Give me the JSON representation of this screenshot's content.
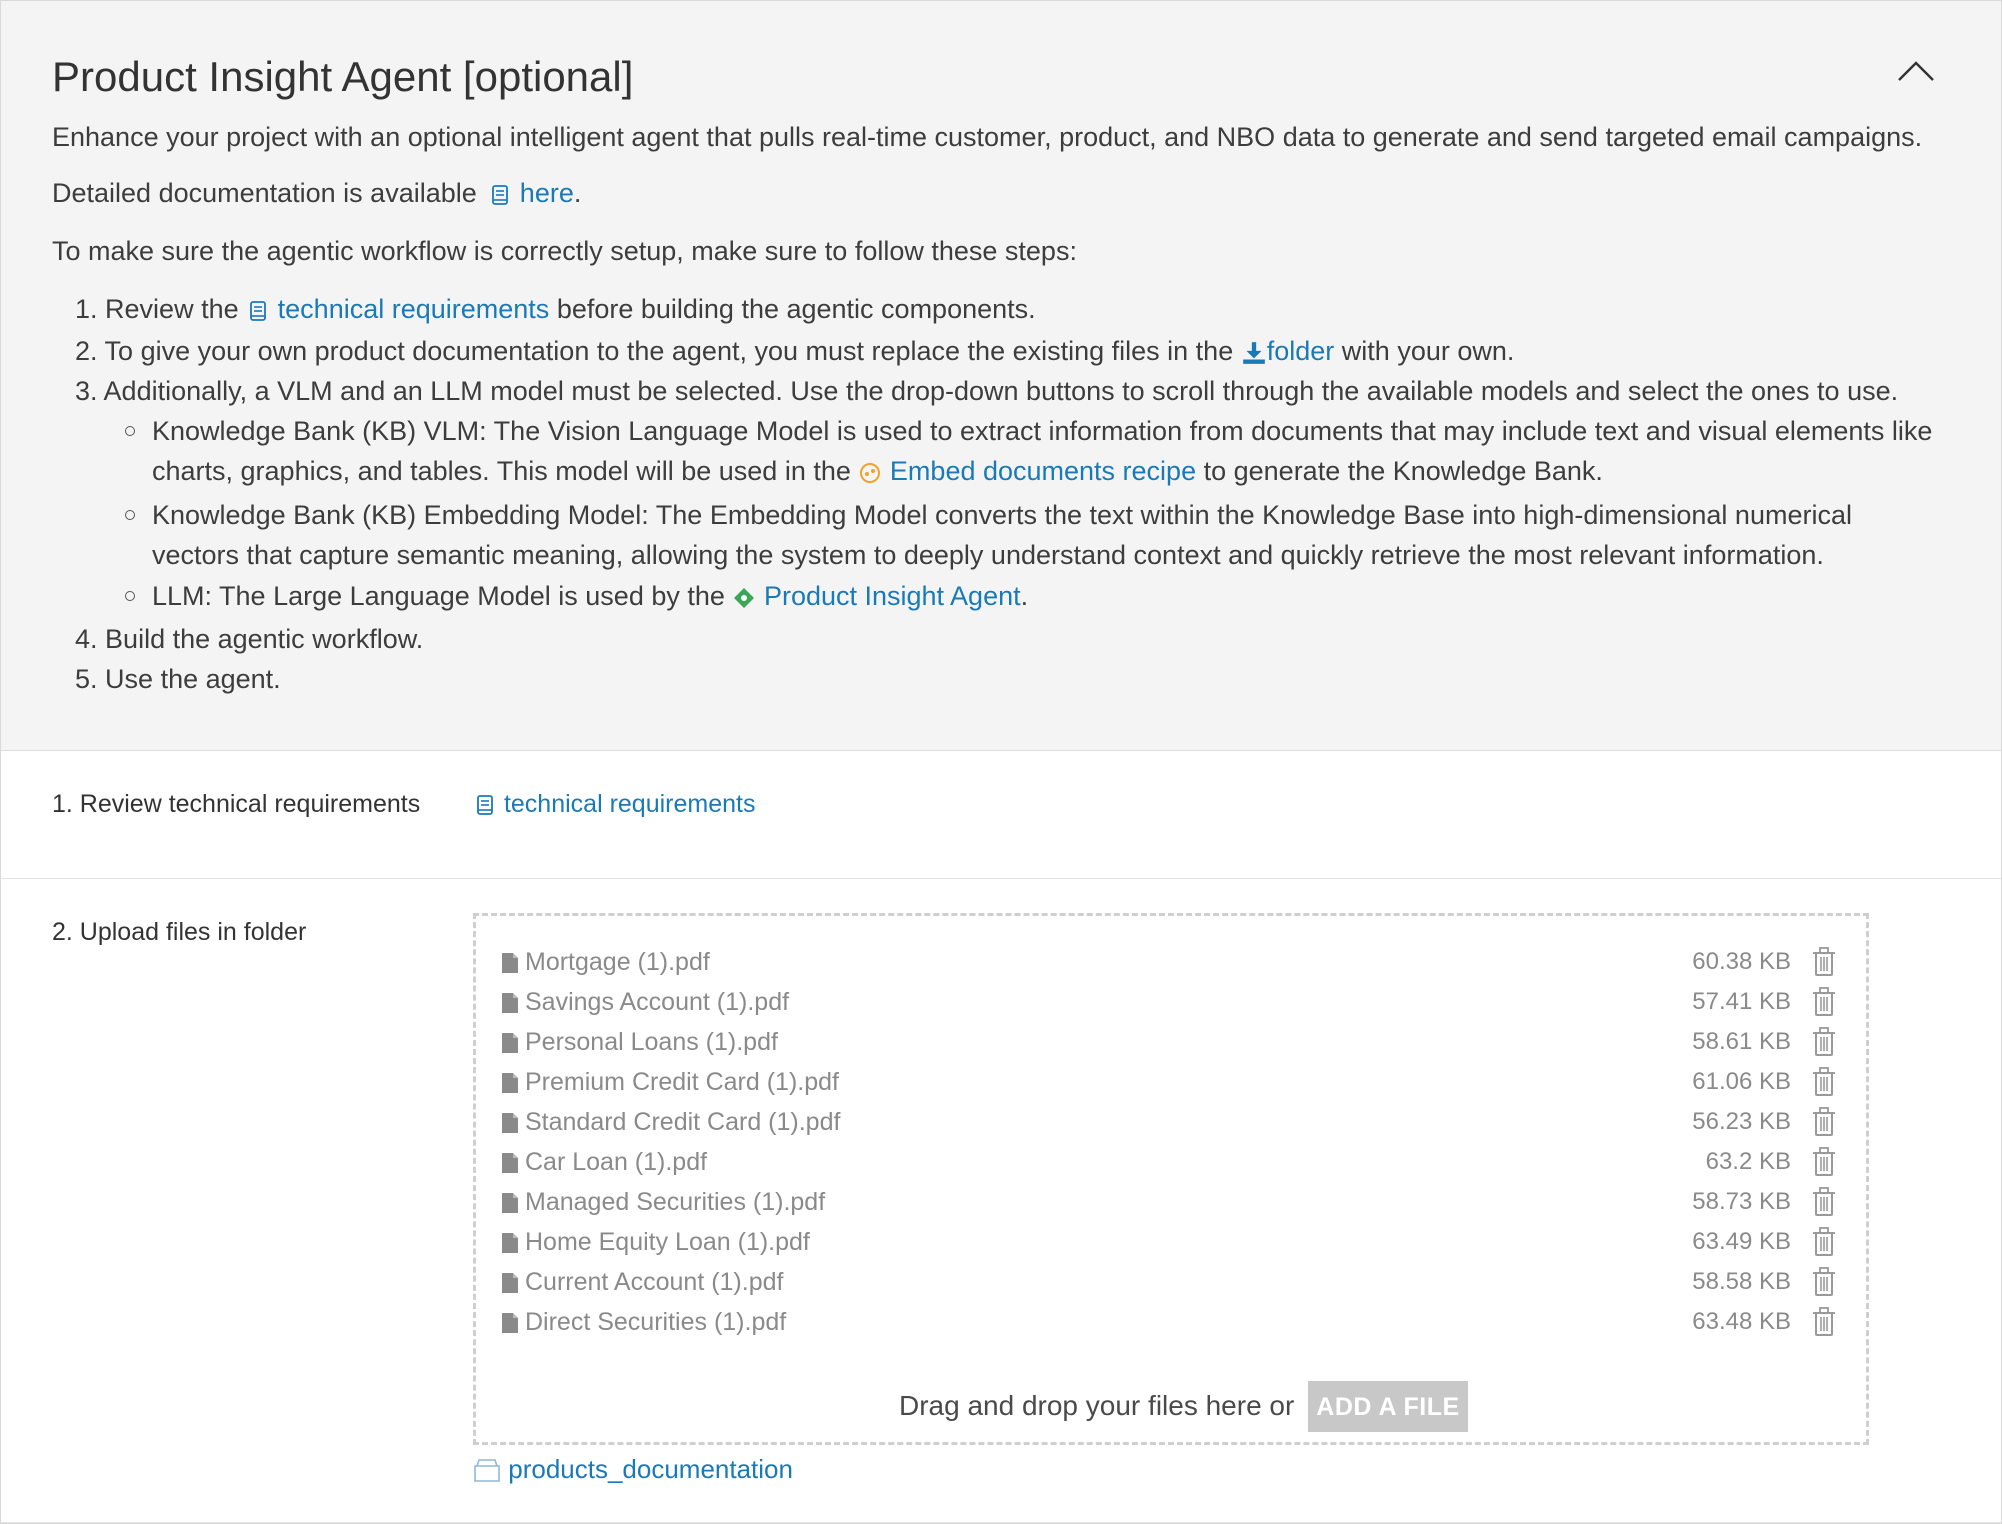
{
  "header": {
    "title": "Product Insight Agent [optional]",
    "intro": "Enhance your project with an optional intelligent agent that pulls real-time customer, product, and NBO data to generate and send targeted email campaigns.",
    "doc_prefix": "Detailed documentation is available",
    "doc_link": "here",
    "doc_suffix": ".",
    "steps_intro": "To make sure the agentic workflow is correctly setup, make sure to follow these steps:"
  },
  "steps": {
    "s1": {
      "num": "1.",
      "prefix": "Review the",
      "link": "technical requirements",
      "suffix": "before building the agentic components."
    },
    "s2": {
      "num": "2.",
      "prefix": "To give your own product documentation to the agent, you must replace the existing files in the",
      "link": "folder",
      "suffix": "with your own."
    },
    "s3": {
      "num": "3.",
      "text": "Additionally, a VLM and an LLM model must be selected. Use the drop-down buttons to scroll through the available models and select the ones to use."
    },
    "b1_line1": "Knowledge Bank (KB) VLM: The Vision Language Model is used to extract information from documents that may include text and visual elements like",
    "b1_line2_prefix": "charts, graphics, and tables. This model will be used in the",
    "b1_link": "Embed documents recipe",
    "b1_line2_suffix": "to generate the Knowledge Bank.",
    "b2_line1": "Knowledge Bank (KB) Embedding Model: The Embedding Model converts the text within the Knowledge Base into high-dimensional numerical",
    "b2_line2": "vectors that capture semantic meaning, allowing the system to deeply understand context and quickly retrieve the most relevant information.",
    "b3_prefix": "LLM: The Large Language Model is used by the",
    "b3_link": "Product Insight Agent",
    "b3_suffix": ".",
    "s4": {
      "num": "4.",
      "text": "Build the agentic workflow."
    },
    "s5": {
      "num": "5.",
      "text": "Use the agent."
    }
  },
  "review": {
    "label": "1. Review technical requirements",
    "link": "technical requirements"
  },
  "upload": {
    "label": "2. Upload files in folder",
    "files": [
      {
        "name": "Mortgage (1).pdf",
        "size": "60.38 KB"
      },
      {
        "name": "Savings Account (1).pdf",
        "size": "57.41 KB"
      },
      {
        "name": "Personal Loans (1).pdf",
        "size": "58.61 KB"
      },
      {
        "name": "Premium Credit Card (1).pdf",
        "size": "61.06 KB"
      },
      {
        "name": "Standard Credit Card (1).pdf",
        "size": "56.23 KB"
      },
      {
        "name": "Car Loan (1).pdf",
        "size": "63.2 KB"
      },
      {
        "name": "Managed Securities (1).pdf",
        "size": "58.73 KB"
      },
      {
        "name": "Home Equity Loan (1).pdf",
        "size": "63.49 KB"
      },
      {
        "name": "Current Account (1).pdf",
        "size": "58.58 KB"
      },
      {
        "name": "Direct Securities (1).pdf",
        "size": "63.48 KB"
      }
    ],
    "drop_text": "Drag and drop your files here or",
    "add_button": "ADD A FILE",
    "folder_name": "products_documentation"
  },
  "colors": {
    "link": "#1a7ab8",
    "panel_bg": "#f4f4f4",
    "muted_text": "#8a8a8a",
    "button_bg": "#c8c8c8"
  },
  "icons": [
    "chevron-up-icon",
    "book-icon",
    "download-icon",
    "recipe-icon",
    "agent-icon",
    "file-icon",
    "trash-icon",
    "folder-icon"
  ]
}
